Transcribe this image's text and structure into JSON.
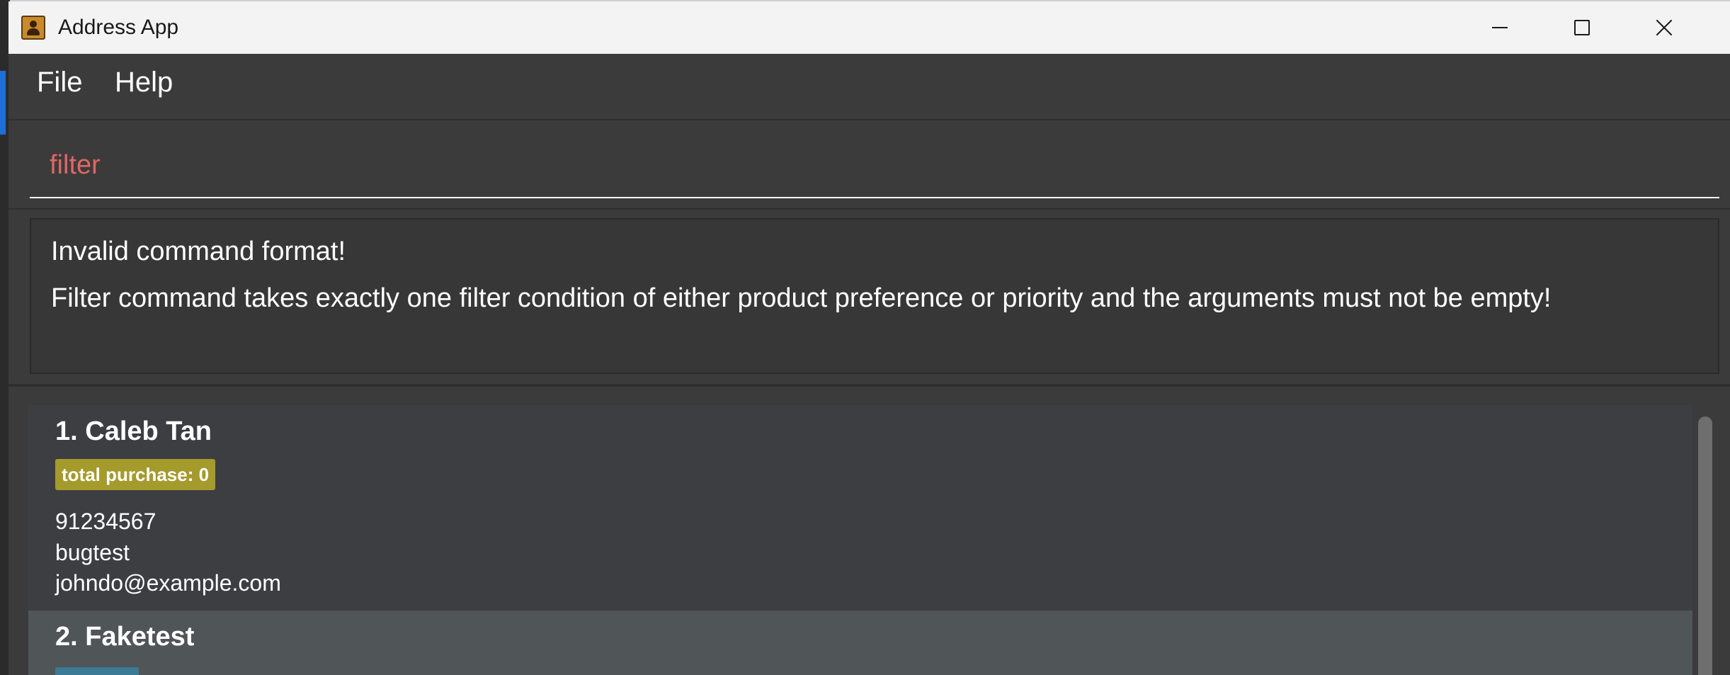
{
  "window": {
    "title": "Address App"
  },
  "menu": {
    "items": [
      {
        "label": "File"
      },
      {
        "label": "Help"
      }
    ]
  },
  "command_box": {
    "value": "filter"
  },
  "result_display": {
    "lines": [
      "Invalid command format!",
      "Filter command takes exactly one filter condition of either product preference or priority and the arguments must not be empty!"
    ]
  },
  "persons": [
    {
      "index_name": "1. Caleb Tan",
      "tag": "total purchase: 0",
      "phone": "91234567",
      "address": "bugtest",
      "email": "johndo@example.com"
    },
    {
      "index_name": "2. Faketest",
      "tag": "",
      "phone": "",
      "address": "",
      "email": ""
    }
  ],
  "colors": {
    "command_text": "#e06666",
    "tag_yellow": "#a59a2c",
    "tag_blue": "#3d7a95",
    "selected_card": "#505558"
  },
  "icons": {
    "app": "address-book-icon",
    "minimize": "minimize-icon",
    "maximize": "maximize-icon",
    "close": "close-icon"
  }
}
